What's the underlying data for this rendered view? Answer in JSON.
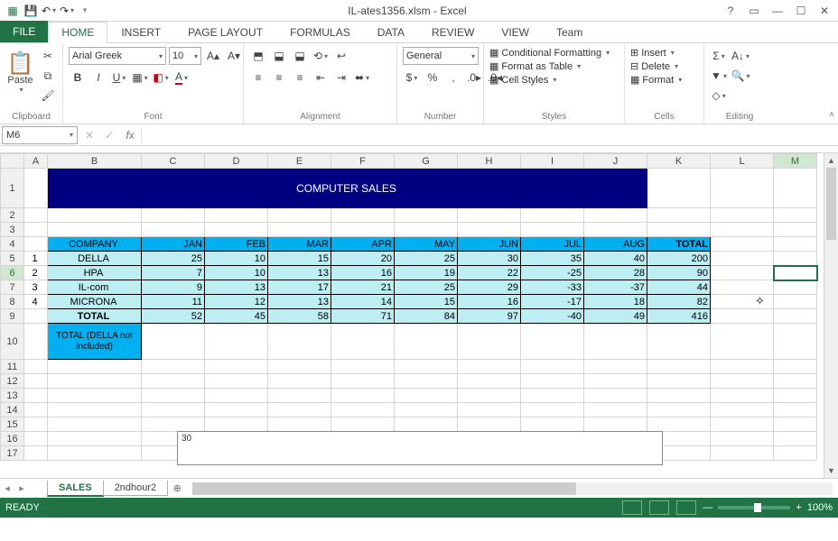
{
  "window": {
    "title": "IL-ates1356.xlsm - Excel"
  },
  "tabs": {
    "file": "FILE",
    "items": [
      "HOME",
      "INSERT",
      "PAGE LAYOUT",
      "FORMULAS",
      "DATA",
      "REVIEW",
      "VIEW",
      "Team"
    ],
    "active": 0
  },
  "ribbon": {
    "clipboard": {
      "paste": "Paste",
      "label": "Clipboard"
    },
    "font": {
      "name": "Arial Greek",
      "size": "10",
      "label": "Font"
    },
    "alignment": {
      "label": "Alignment"
    },
    "number": {
      "format": "General",
      "label": "Number"
    },
    "styles": {
      "cond": "Conditional Formatting",
      "table": "Format as Table",
      "cell": "Cell Styles",
      "label": "Styles"
    },
    "cells": {
      "insert": "Insert",
      "delete": "Delete",
      "format": "Format",
      "label": "Cells"
    },
    "editing": {
      "label": "Editing"
    }
  },
  "namebox": "M6",
  "formula": "",
  "columns": [
    "A",
    "B",
    "C",
    "D",
    "E",
    "F",
    "G",
    "H",
    "I",
    "J",
    "K",
    "L",
    "M"
  ],
  "title_cell": "COMPUTER SALES",
  "headers": {
    "company": "COMPANY",
    "months": [
      "JAN",
      "FEB",
      "MAR",
      "APR",
      "MAY",
      "JUN",
      "JUL",
      "AUG"
    ],
    "total": "TOTAL"
  },
  "rows": [
    {
      "n": "1",
      "name": "DELLA",
      "vals": [
        25,
        10,
        15,
        20,
        25,
        30,
        35,
        40
      ],
      "total": 200
    },
    {
      "n": "2",
      "name": "HPA",
      "vals": [
        7,
        10,
        13,
        16,
        19,
        22,
        -25,
        28
      ],
      "total": 90
    },
    {
      "n": "3",
      "name": "IL-com",
      "vals": [
        9,
        13,
        17,
        21,
        25,
        29,
        -33,
        -37
      ],
      "total": 44
    },
    {
      "n": "4",
      "name": "MICRONA",
      "vals": [
        11,
        12,
        13,
        14,
        15,
        16,
        -17,
        18
      ],
      "total": 82
    }
  ],
  "grand": {
    "label": "TOTAL",
    "vals": [
      52,
      45,
      58,
      71,
      84,
      97,
      -40,
      49
    ],
    "total": 416
  },
  "note": "TOTAL   (DELLA not included)",
  "chart_y_first": "30",
  "sheets": {
    "active": "SALES",
    "other": "2ndhour2"
  },
  "status": {
    "ready": "READY",
    "zoom": "100%"
  },
  "chart_data": {
    "type": "bar",
    "note": "only top of chart visible; single y-tick '30' shown",
    "ylim_visible": [
      0,
      30
    ]
  }
}
